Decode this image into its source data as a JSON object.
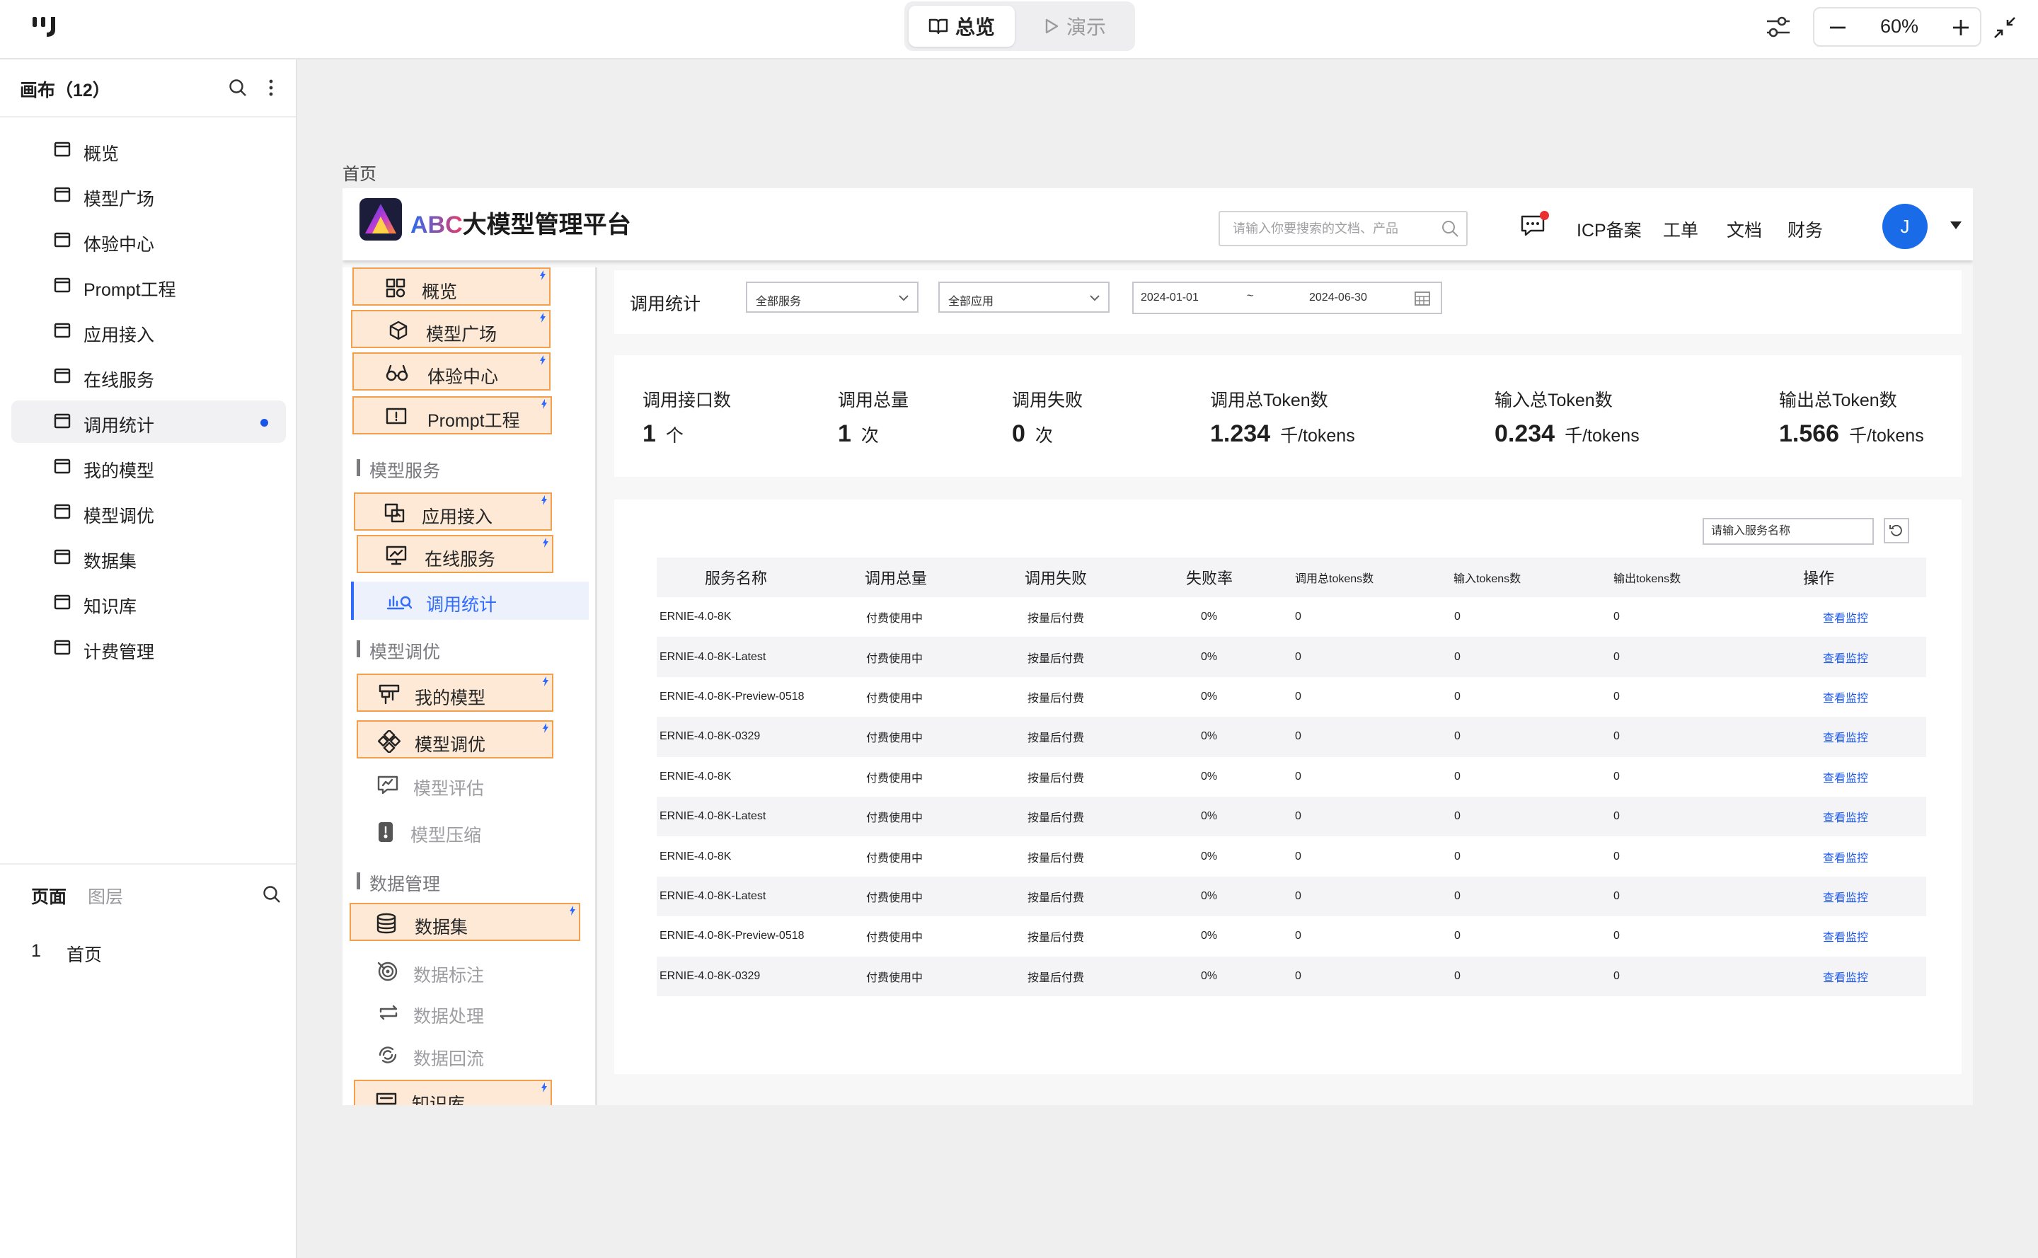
{
  "topbar": {
    "mode_overview": "总览",
    "mode_present": "演示",
    "zoom": "60%"
  },
  "canvas_panel": {
    "title": "画布（12）",
    "items": [
      {
        "label": "概览"
      },
      {
        "label": "模型广场"
      },
      {
        "label": "体验中心"
      },
      {
        "label": "Prompt工程"
      },
      {
        "label": "应用接入"
      },
      {
        "label": "在线服务"
      },
      {
        "label": "调用统计",
        "active": true
      },
      {
        "label": "我的模型"
      },
      {
        "label": "模型调优"
      },
      {
        "label": "数据集"
      },
      {
        "label": "知识库"
      },
      {
        "label": "计费管理"
      }
    ]
  },
  "pages_panel": {
    "tab_pages": "页面",
    "tab_layers": "图层",
    "pages": [
      {
        "number": "1",
        "name": "首页"
      }
    ]
  },
  "frame": {
    "label": "首页"
  },
  "app": {
    "brand_abc": "ABC",
    "brand_rest": "大模型管理平台",
    "search_placeholder": "请输入你要搜索的文档、产品",
    "nav": [
      "ICP备案",
      "工单",
      "文档",
      "财务"
    ],
    "avatar_letter": "J",
    "colors": {
      "accent": "#2f6bff",
      "highlight_bg": "#fde9d6",
      "highlight_border": "#f2a04d",
      "link": "#1a56e8",
      "notice": "#e92f2f"
    }
  },
  "sidebar": {
    "items": [
      {
        "label": "概览",
        "icon": "grid-icon",
        "highlight": true
      },
      {
        "label": "模型广场",
        "icon": "cube-icon",
        "highlight": true
      },
      {
        "label": "体验中心",
        "icon": "glasses-icon",
        "highlight": true
      },
      {
        "label": "Prompt工程",
        "icon": "prompt-icon",
        "highlight": true
      },
      {
        "section": "模型服务"
      },
      {
        "label": "应用接入",
        "icon": "app-access-icon",
        "highlight": true
      },
      {
        "label": "在线服务",
        "icon": "monitor-icon",
        "highlight": true
      },
      {
        "label": "调用统计",
        "icon": "stats-icon",
        "selected": true
      },
      {
        "section": "模型调优"
      },
      {
        "label": "我的模型",
        "icon": "model-icon",
        "highlight": true
      },
      {
        "label": "模型调优",
        "icon": "tuning-icon",
        "highlight": true
      },
      {
        "label": "模型评估",
        "icon": "evaluate-icon",
        "dim": true
      },
      {
        "label": "模型压缩",
        "icon": "compress-icon",
        "dim": true
      },
      {
        "section": "数据管理"
      },
      {
        "label": "数据集",
        "icon": "database-icon",
        "highlight": true
      },
      {
        "label": "数据标注",
        "icon": "target-icon",
        "dim": true
      },
      {
        "label": "数据处理",
        "icon": "process-icon",
        "dim": true
      },
      {
        "label": "数据回流",
        "icon": "reflow-icon",
        "dim": true
      },
      {
        "label": "知识库",
        "icon": "knowledge-icon",
        "highlight": true
      }
    ]
  },
  "filters": {
    "title": "调用统计",
    "service": "全部服务",
    "app": "全部应用",
    "date_start": "2024-01-01",
    "date_sep": "~",
    "date_end": "2024-06-30"
  },
  "stats": [
    {
      "label": "调用接口数",
      "value": "1",
      "unit": "个"
    },
    {
      "label": "调用总量",
      "value": "1",
      "unit": "次"
    },
    {
      "label": "调用失败",
      "value": "0",
      "unit": "次"
    },
    {
      "label": "调用总Token数",
      "value": "1.234",
      "unit": "千/tokens"
    },
    {
      "label": "输入总Token数",
      "value": "0.234",
      "unit": "千/tokens"
    },
    {
      "label": "输出总Token数",
      "value": "1.566",
      "unit": "千/tokens"
    }
  ],
  "table": {
    "search_placeholder": "请输入服务名称",
    "columns": [
      "服务名称",
      "调用总量",
      "调用失败",
      "失败率",
      "调用总tokens数",
      "输入tokens数",
      "输出tokens数",
      "操作"
    ],
    "rows": [
      [
        "ERNIE-4.0-8K",
        "付费使用中",
        "按量后付费",
        "0%",
        "0",
        "0",
        "0",
        "查看监控"
      ],
      [
        "ERNIE-4.0-8K-Latest",
        "付费使用中",
        "按量后付费",
        "0%",
        "0",
        "0",
        "0",
        "查看监控"
      ],
      [
        "ERNIE-4.0-8K-Preview-0518",
        "付费使用中",
        "按量后付费",
        "0%",
        "0",
        "0",
        "0",
        "查看监控"
      ],
      [
        "ERNIE-4.0-8K-0329",
        "付费使用中",
        "按量后付费",
        "0%",
        "0",
        "0",
        "0",
        "查看监控"
      ],
      [
        "ERNIE-4.0-8K",
        "付费使用中",
        "按量后付费",
        "0%",
        "0",
        "0",
        "0",
        "查看监控"
      ],
      [
        "ERNIE-4.0-8K-Latest",
        "付费使用中",
        "按量后付费",
        "0%",
        "0",
        "0",
        "0",
        "查看监控"
      ],
      [
        "ERNIE-4.0-8K",
        "付费使用中",
        "按量后付费",
        "0%",
        "0",
        "0",
        "0",
        "查看监控"
      ],
      [
        "ERNIE-4.0-8K-Latest",
        "付费使用中",
        "按量后付费",
        "0%",
        "0",
        "0",
        "0",
        "查看监控"
      ],
      [
        "ERNIE-4.0-8K-Preview-0518",
        "付费使用中",
        "按量后付费",
        "0%",
        "0",
        "0",
        "0",
        "查看监控"
      ],
      [
        "ERNIE-4.0-8K-0329",
        "付费使用中",
        "按量后付费",
        "0%",
        "0",
        "0",
        "0",
        "查看监控"
      ]
    ]
  }
}
